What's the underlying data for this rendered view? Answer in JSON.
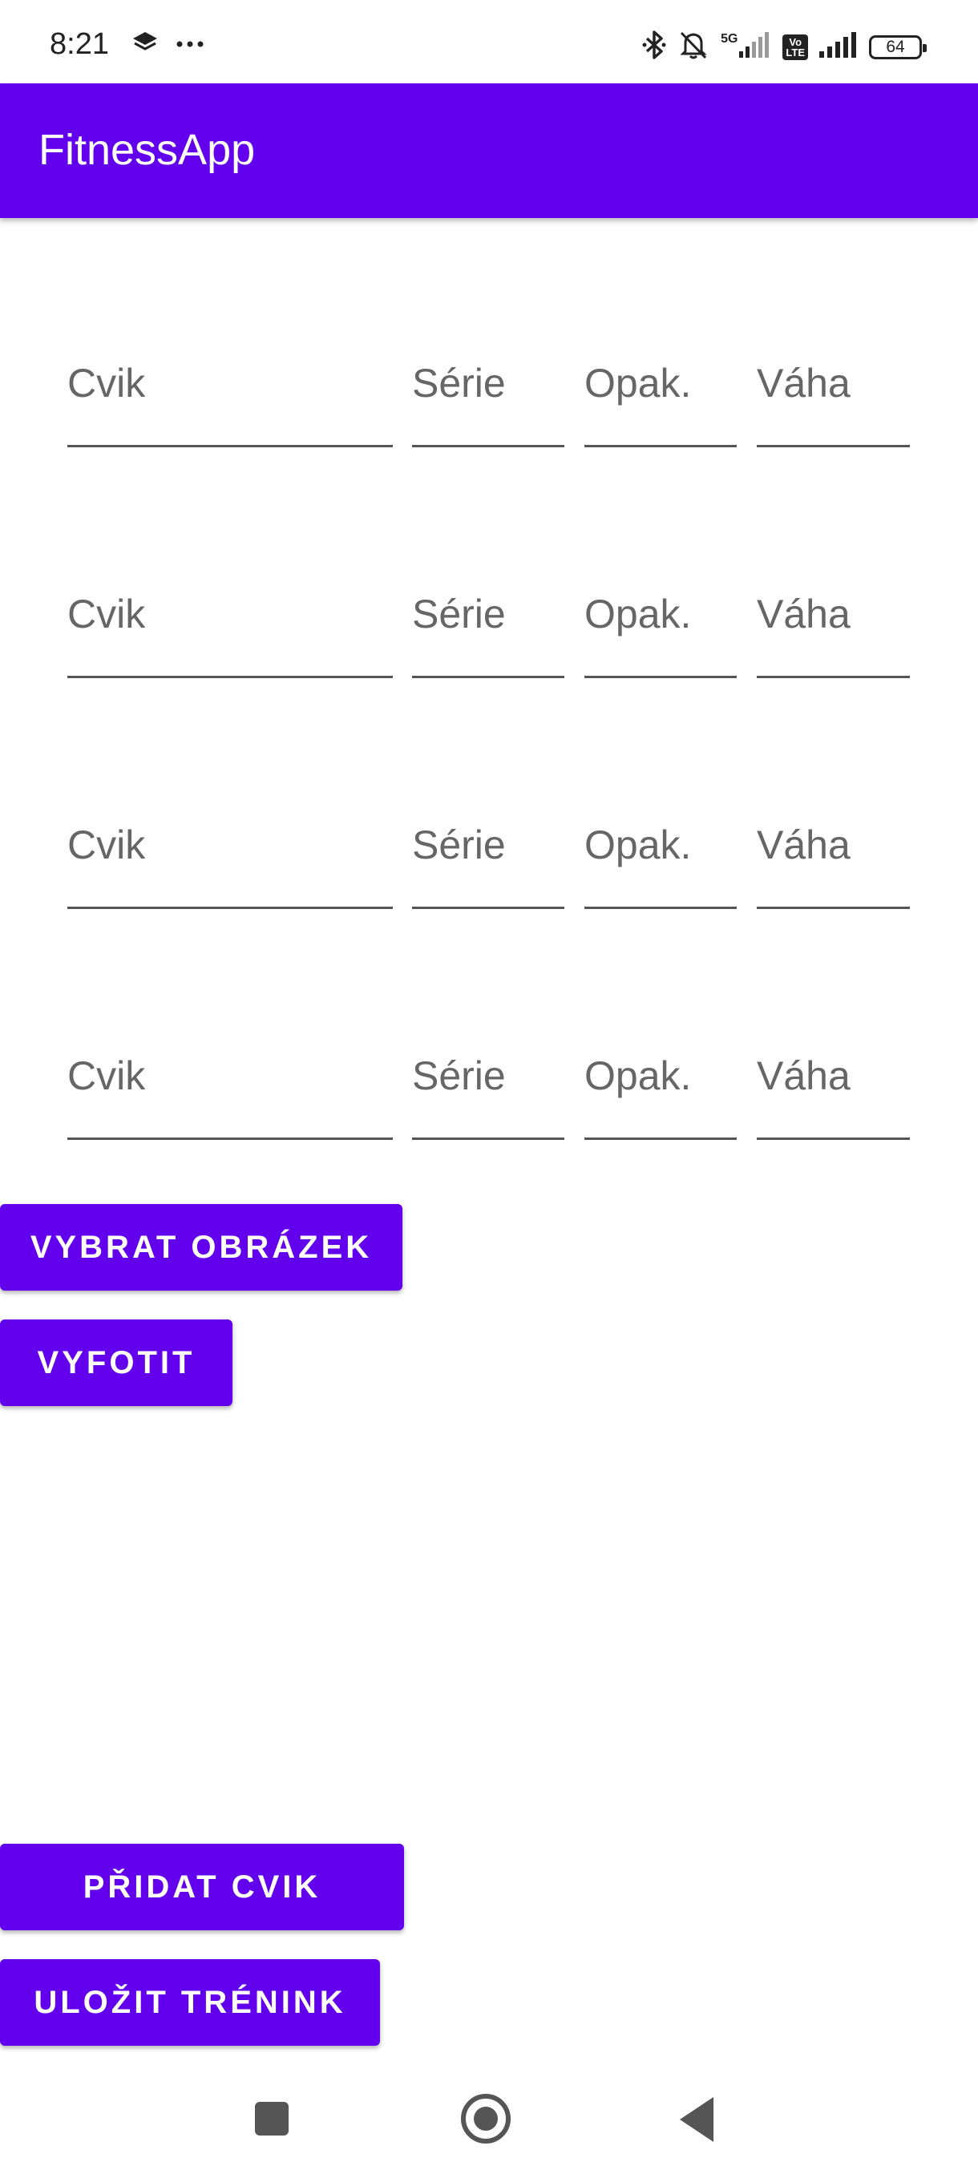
{
  "status_bar": {
    "time": "8:21",
    "network_label": "5G",
    "volte_label": "Vo LTE",
    "battery_level": "64",
    "icons": [
      "layers-icon",
      "more-dots-icon",
      "bluetooth-icon",
      "bell-muted-icon",
      "signal-icon",
      "volte-icon",
      "signal-icon",
      "battery-icon"
    ]
  },
  "app_bar": {
    "title": "FitnessApp"
  },
  "exercise_rows": [
    {
      "cvik_placeholder": "Cvik",
      "serie_placeholder": "Série",
      "opak_placeholder": "Opak.",
      "vaha_placeholder": "Váha"
    },
    {
      "cvik_placeholder": "Cvik",
      "serie_placeholder": "Série",
      "opak_placeholder": "Opak.",
      "vaha_placeholder": "Váha"
    },
    {
      "cvik_placeholder": "Cvik",
      "serie_placeholder": "Série",
      "opak_placeholder": "Opak.",
      "vaha_placeholder": "Váha"
    },
    {
      "cvik_placeholder": "Cvik",
      "serie_placeholder": "Série",
      "opak_placeholder": "Opak.",
      "vaha_placeholder": "Váha"
    }
  ],
  "buttons": {
    "choose_image": "VYBRAT OBRÁZEK",
    "take_photo": "VYFOTIT",
    "add_exercise": "PŘIDAT CVIK",
    "save_training": "ULOŽIT TRÉNINK"
  },
  "colors": {
    "primary": "#6200ee",
    "on_primary": "#ffffff",
    "underline": "#555555",
    "placeholder": "#666666"
  }
}
